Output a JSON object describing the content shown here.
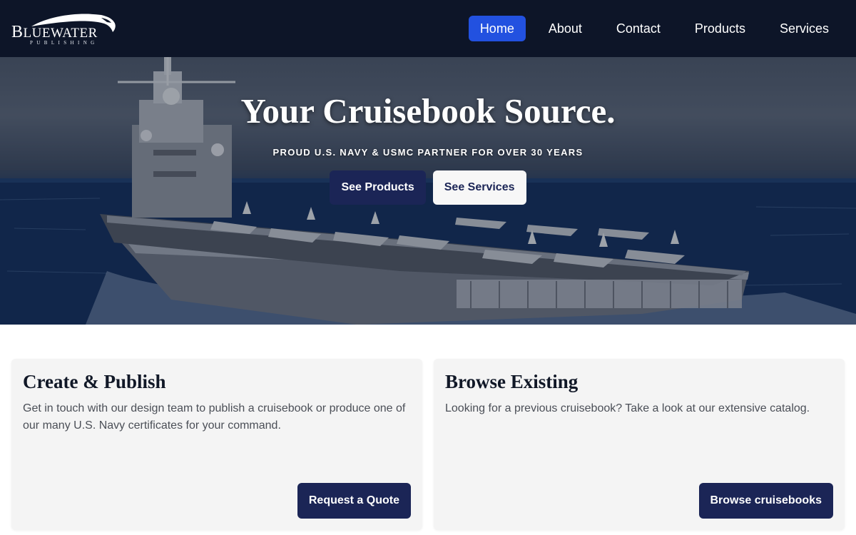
{
  "brand": {
    "name_big": "B",
    "name_rest": "LUEWATER",
    "tagline": "PUBLISHING"
  },
  "nav": {
    "items": [
      {
        "label": "Home",
        "active": true
      },
      {
        "label": "About",
        "active": false
      },
      {
        "label": "Contact",
        "active": false
      },
      {
        "label": "Products",
        "active": false
      },
      {
        "label": "Services",
        "active": false
      }
    ]
  },
  "hero": {
    "title": "Your Cruisebook Source.",
    "subtitle": "PROUD U.S. NAVY & USMC PARTNER FOR OVER 30 YEARS",
    "primary_button": "See Products",
    "secondary_button": "See Services"
  },
  "cards": [
    {
      "title": "Create & Publish",
      "text": "Get in touch with our design team to publish a cruisebook or produce one of our many U.S. Navy certificates for your command.",
      "button": "Request a Quote"
    },
    {
      "title": "Browse Existing",
      "text": "Looking for a previous cruisebook? Take a look at our extensive catalog.",
      "button": "Browse cruisebooks"
    }
  ],
  "colors": {
    "header_bg": "#0d1528",
    "nav_active": "#2251e0",
    "button_dark": "#1b2556",
    "card_bg": "#f4f4f4"
  }
}
